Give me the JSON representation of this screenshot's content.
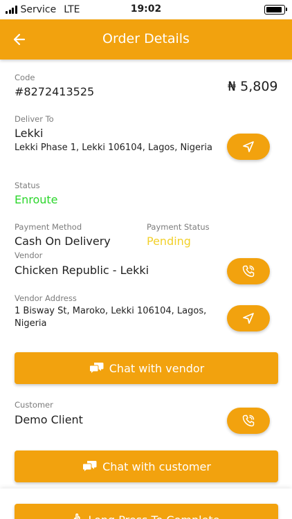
{
  "status_bar": {
    "carrier": "Service",
    "network": "LTE",
    "time": "19:02"
  },
  "header": {
    "title": "Order Details"
  },
  "order": {
    "code_label": "Code",
    "code": "#8272413525",
    "amount": "₦ 5,809",
    "deliver_to_label": "Deliver To",
    "deliver_to_name": "Lekki",
    "deliver_to_address": "Lekki Phase 1, Lekki 106104, Lagos, Nigeria",
    "status_label": "Status",
    "status": "Enroute",
    "payment_method_label": "Payment Method",
    "payment_method": "Cash On Delivery",
    "payment_status_label": "Payment Status",
    "payment_status": "Pending",
    "vendor_label": "Vendor",
    "vendor": "Chicken Republic - Lekki",
    "vendor_address_label": "Vendor Address",
    "vendor_address": "1 Bisway St, Maroko, Lekki 106104, Lagos, Nigeria",
    "customer_label": "Customer",
    "customer": "Demo Client"
  },
  "actions": {
    "chat_vendor": "Chat with vendor",
    "chat_customer": "Chat with customer",
    "complete": "Long Press To Complete"
  },
  "colors": {
    "primary": "#f2a20e",
    "status_enroute": "#2bd62b",
    "payment_pending": "#f2d02a"
  },
  "icons": {
    "back": "arrow-left-icon",
    "navigate": "navigation-arrow-icon",
    "call": "phone-call-icon",
    "chat": "chat-bubbles-icon"
  }
}
